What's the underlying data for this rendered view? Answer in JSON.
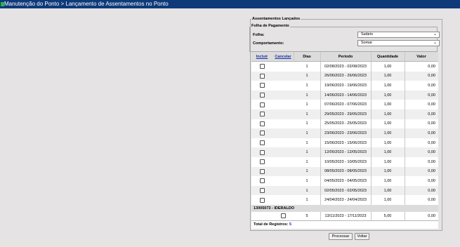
{
  "titlebar": {
    "title": "Manutenção do Ponto > Lançamento de Assentamentos no Ponto"
  },
  "panel": {
    "legend": "Assentamentos Lançados",
    "folha_legend": "Folha de Pagamento",
    "folha_label": "Folha:",
    "folha_value": "Salário",
    "comportamento_label": "Comportamento:",
    "comportamento_value": "Somar"
  },
  "table": {
    "headers": {
      "incluir": "Incluir",
      "cancelar": "Cancelar",
      "dias": "Dias",
      "periodo": "Periodo",
      "quantidade": "Quantidade",
      "valor": "Valor"
    },
    "rows": [
      {
        "dias": "1",
        "periodo": "02/08/2023 - 02/08/2023",
        "quantidade": "1,00",
        "valor": "0,00"
      },
      {
        "dias": "1",
        "periodo": "26/06/2023 - 26/06/2023",
        "quantidade": "1,00",
        "valor": "0,00"
      },
      {
        "dias": "1",
        "periodo": "19/06/2023 - 19/06/2023",
        "quantidade": "1,00",
        "valor": "0,00"
      },
      {
        "dias": "1",
        "periodo": "14/06/2023 - 14/06/2023",
        "quantidade": "1,00",
        "valor": "0,00"
      },
      {
        "dias": "1",
        "periodo": "07/06/2023 - 07/06/2023",
        "quantidade": "1,00",
        "valor": "0,00"
      },
      {
        "dias": "1",
        "periodo": "29/05/2023 - 29/05/2023",
        "quantidade": "1,00",
        "valor": "0,00"
      },
      {
        "dias": "1",
        "periodo": "25/05/2023 - 25/05/2023",
        "quantidade": "1,00",
        "valor": "0,00"
      },
      {
        "dias": "1",
        "periodo": "23/06/2023 - 23/06/2023",
        "quantidade": "1,00",
        "valor": "0,00"
      },
      {
        "dias": "1",
        "periodo": "15/06/2023 - 15/06/2023",
        "quantidade": "1,00",
        "valor": "0,00"
      },
      {
        "dias": "1",
        "periodo": "12/05/2023 - 12/05/2023",
        "quantidade": "1,00",
        "valor": "0,00"
      },
      {
        "dias": "1",
        "periodo": "10/05/2023 - 10/05/2023",
        "quantidade": "1,00",
        "valor": "0,00"
      },
      {
        "dias": "1",
        "periodo": "08/05/2023 - 08/05/2023",
        "quantidade": "1,00",
        "valor": "0,00"
      },
      {
        "dias": "1",
        "periodo": "04/05/2023 - 04/05/2023",
        "quantidade": "1,00",
        "valor": "0,00"
      },
      {
        "dias": "1",
        "periodo": "02/05/2023 - 02/05/2023",
        "quantidade": "1,00",
        "valor": "0,00"
      },
      {
        "dias": "1",
        "periodo": "24/04/2023 - 24/04/2023",
        "quantidade": "1,00",
        "valor": "0,00"
      }
    ],
    "group_label": "13005073 - IDERALDO",
    "group_row": {
      "dias": "5",
      "periodo": "13/11/2023 - 17/11/2023",
      "quantidade": "5,00",
      "valor": "0,00"
    },
    "total_label": "Total de Registros:",
    "total_count": "5"
  },
  "buttons": {
    "processar": "Processar",
    "voltar": "Voltar"
  }
}
